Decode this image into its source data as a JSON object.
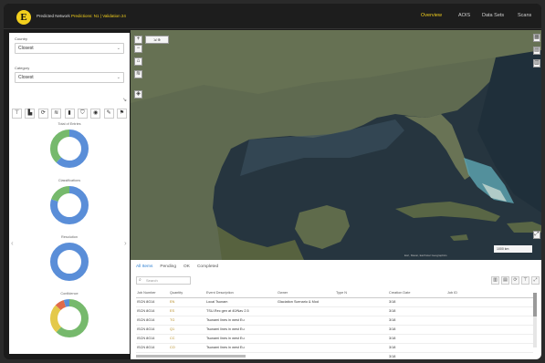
{
  "header": {
    "title_prefix": "Predicted Network",
    "title_highlight": "Predictions: N1 | Validation 24",
    "nav": [
      "Overview",
      "AOIS",
      "Data Sets",
      "Scans"
    ],
    "active_nav": "Overview"
  },
  "filters": [
    {
      "label": "Country",
      "value": "Closest"
    },
    {
      "label": "Category",
      "value": "Closest"
    }
  ],
  "donuts": [
    {
      "label": "Total of Entries",
      "segments": [
        {
          "value": 0.62,
          "color": "#5a8ed8"
        },
        {
          "value": 0.38,
          "color": "#76b96c"
        }
      ]
    },
    {
      "label": "Classifications",
      "segments": [
        {
          "value": 0.8,
          "color": "#5a8ed8"
        },
        {
          "value": 0.2,
          "color": "#76b96c"
        }
      ]
    },
    {
      "label": "Resolution",
      "segments": [
        {
          "value": 1.0,
          "color": "#5a8ed8"
        }
      ]
    },
    {
      "label": "Confidence",
      "segments": [
        {
          "value": 0.62,
          "color": "#76b96c"
        },
        {
          "value": 0.25,
          "color": "#e4c94a"
        },
        {
          "value": 0.08,
          "color": "#e06a4a"
        },
        {
          "value": 0.05,
          "color": "#5a8ed8"
        }
      ]
    }
  ],
  "table": {
    "tabs": [
      "All Items",
      "Pending",
      "OK",
      "Completed"
    ],
    "active_tab": "All Items",
    "search_placeholder": "Search",
    "columns": [
      "Job Number",
      "",
      "Quantity",
      "Event Description",
      "",
      "Owner",
      "",
      "Type N",
      "",
      "Creation Date",
      "",
      "Job ID",
      ""
    ],
    "rows": [
      [
        "ISCN 8G14",
        "",
        "EN",
        "Local Tsunam",
        "",
        "Glaciation Scenario & Mod",
        "",
        "",
        "",
        "3/18",
        "",
        "",
        ""
      ],
      [
        "ISCN 8G14",
        "",
        "ES",
        "TSU-Rec gen at 40/Nav 2.5",
        "",
        "",
        "",
        "",
        "",
        "3/18",
        "",
        "",
        ""
      ],
      [
        "ISCN 8G14",
        "",
        "TG",
        "Tsunami lines in west Eu",
        "",
        "",
        "",
        "",
        "",
        "3/18",
        "",
        "",
        ""
      ],
      [
        "ISCN 8G14",
        "",
        "Q1",
        "Tsunami lines in west Eu",
        "",
        "",
        "",
        "",
        "",
        "3/18",
        "",
        "",
        ""
      ],
      [
        "ISCN 8G14",
        "",
        "CC",
        "Tsunami lines in west Eu",
        "",
        "",
        "",
        "",
        "",
        "3/18",
        "",
        "",
        ""
      ],
      [
        "ISCN 8G14",
        "",
        "CO",
        "Tsunami lines in west Eu",
        "",
        "",
        "",
        "",
        "",
        "3/18",
        "",
        "",
        ""
      ],
      [
        "ISCN 8G14",
        "",
        "CC",
        "Tsunami lines in west Eu",
        "",
        "",
        "",
        "",
        "",
        "3/18",
        "",
        "",
        ""
      ]
    ]
  },
  "map": {
    "attribution": "Esri, Maxar, Earthstar Geographics",
    "scale_label": "1000 km"
  },
  "colors": {
    "accent": "#f2cf1d",
    "link": "#2e7fd1"
  }
}
